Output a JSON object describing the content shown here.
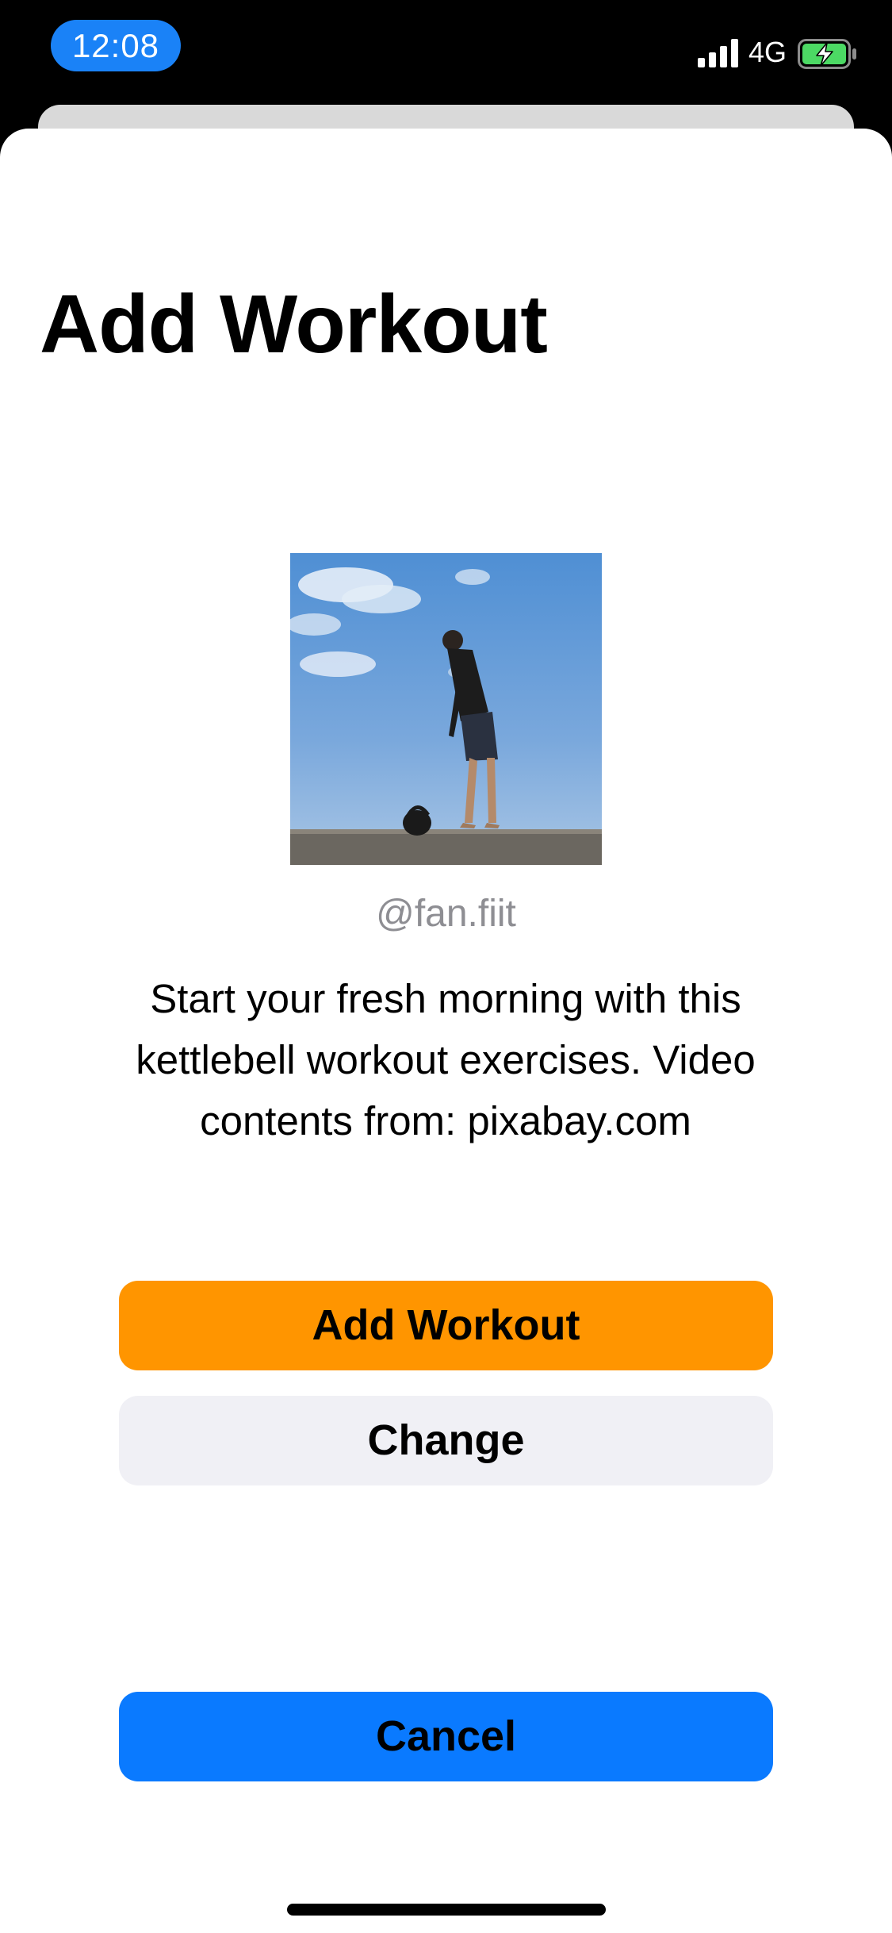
{
  "status_bar": {
    "time": "12:08",
    "network": "4G",
    "signal_icon": "cellular-signal-icon",
    "battery_icon": "battery-charging-icon",
    "time_pill_color": "#1a82f7",
    "battery_color": "#4cd964"
  },
  "sheet": {
    "title": "Add Workout",
    "thumbnail": {
      "icon": "workout-video-thumbnail"
    },
    "author": "@fan.fiit",
    "description": "Start your fresh morning with this kettlebell workout exercises. Video contents from: pixabay.com"
  },
  "buttons": {
    "add_label": "Add Workout",
    "add_color": "#ff9500",
    "change_label": "Change",
    "change_color": "#f0f0f5",
    "cancel_label": "Cancel",
    "cancel_color": "#0a7aff"
  }
}
